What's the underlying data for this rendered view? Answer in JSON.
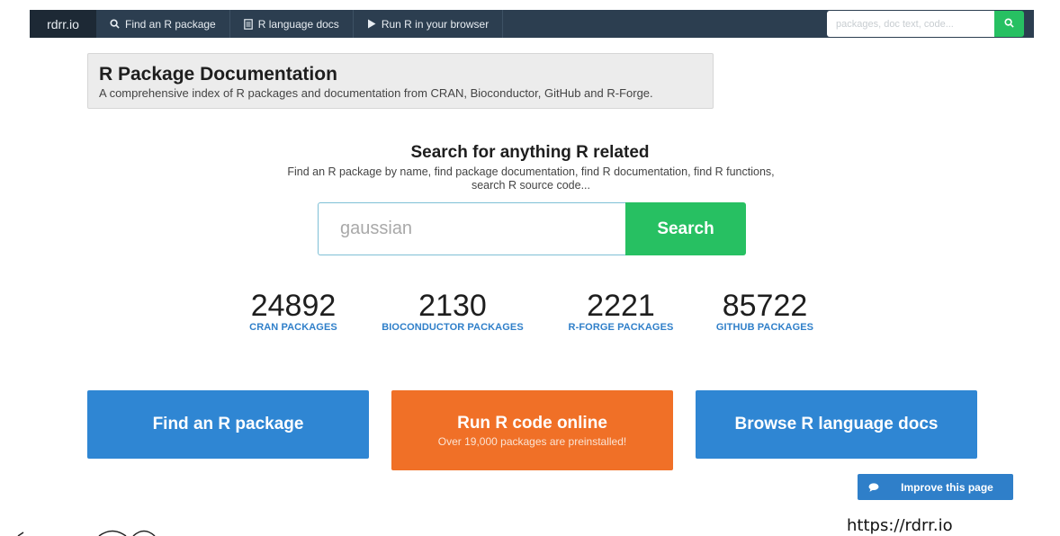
{
  "navbar": {
    "brand": "rdrr.io",
    "items": [
      {
        "label": "Find an R package",
        "icon": "search-icon"
      },
      {
        "label": "R language docs",
        "icon": "document-icon"
      },
      {
        "label": "Run R in your browser",
        "icon": "play-icon"
      }
    ],
    "search_placeholder": "packages, doc text, code...",
    "search_icon": "search-icon"
  },
  "header": {
    "title": "R Package Documentation",
    "subtitle": "A comprehensive index of R packages and documentation from CRAN, Bioconductor, GitHub and R-Forge."
  },
  "search": {
    "title": "Search for anything R related",
    "description": "Find an R package by name, find package documentation, find R documentation, find R functions, search R source code...",
    "placeholder": "gaussian",
    "button_label": "Search"
  },
  "stats": [
    {
      "value": "24892",
      "label": "CRAN PACKAGES"
    },
    {
      "value": "2130",
      "label": "BIOCONDUCTOR PACKAGES"
    },
    {
      "value": "2221",
      "label": "R-FORGE PACKAGES"
    },
    {
      "value": "85722",
      "label": "GITHUB PACKAGES"
    }
  ],
  "actions": [
    {
      "label": "Find an R package",
      "color": "#2f86d3"
    },
    {
      "label": "Run R code online",
      "sublabel": "Over 19,000 packages are preinstalled!",
      "color": "#f07027"
    },
    {
      "label": "Browse R language docs",
      "color": "#2f86d3"
    }
  ],
  "improve": {
    "label": "Improve this page",
    "icon": "comment-icon"
  },
  "url": "https://rdrr.io",
  "colors": {
    "navbar": "#2c3e50",
    "accent_green": "#27c062",
    "link_blue": "#2f7fc9"
  }
}
